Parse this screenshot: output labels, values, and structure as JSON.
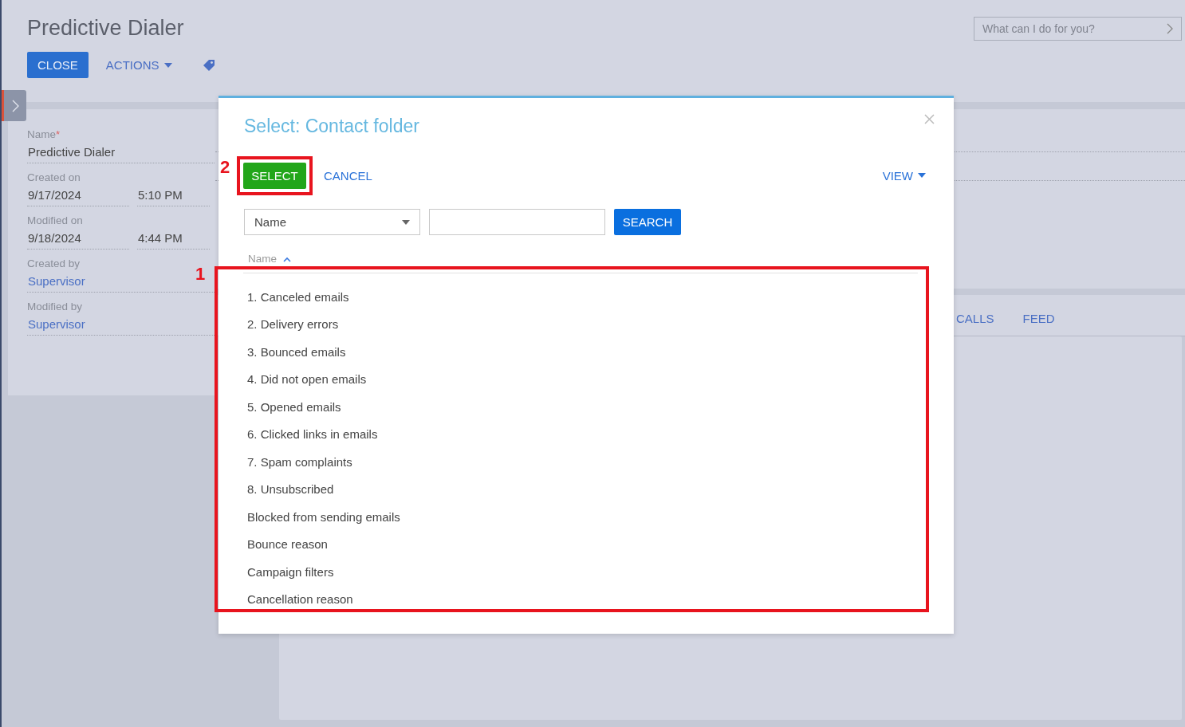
{
  "header": {
    "title": "Predictive Dialer",
    "buttons": [
      {
        "label": "CLOSE",
        "kind": "primary"
      },
      {
        "label": "ACTIONS",
        "kind": "menu"
      },
      {
        "kind": "tag"
      }
    ],
    "assistant": {
      "placeholder": "What can I do for you?"
    }
  },
  "fields": [
    {
      "kind": "text",
      "label": "Name",
      "required_mark": "*",
      "value": "Predictive Dialer"
    },
    {
      "kind": "datetime",
      "label": "Created on",
      "date": "9/17/2024",
      "time": "5:10 PM"
    },
    {
      "kind": "datetime",
      "label": "Modified on",
      "date": "9/18/2024",
      "time": "4:44 PM"
    },
    {
      "kind": "link",
      "label": "Created by",
      "value": "Supervisor"
    },
    {
      "kind": "link",
      "label": "Modified by",
      "value": "Supervisor"
    }
  ],
  "tabs": [
    {
      "label": "CALLS",
      "selected": false
    },
    {
      "label": "FEED",
      "selected": false
    }
  ],
  "dialog": {
    "title": "Select: Contact folder",
    "buttons": [
      {
        "label": "SELECT",
        "kind": "primary"
      },
      {
        "label": "CANCEL",
        "kind": "link"
      }
    ],
    "view": "VIEW",
    "filter": {
      "column": "Name",
      "button": "SEARCH"
    },
    "column": {
      "label": "Name",
      "sort_ascending": true
    },
    "rows": [
      "1. Canceled emails",
      "2. Delivery errors",
      "3. Bounced emails",
      "4. Did not open emails",
      "5. Opened emails",
      "6. Clicked links in emails",
      "7. Spam complaints",
      "8. Unsubscribed",
      "Blocked from sending emails",
      "Bounce reason",
      "Campaign filters",
      "Cancellation reason"
    ]
  },
  "annotations": [
    {
      "number": "1"
    },
    {
      "number": "2"
    }
  ]
}
